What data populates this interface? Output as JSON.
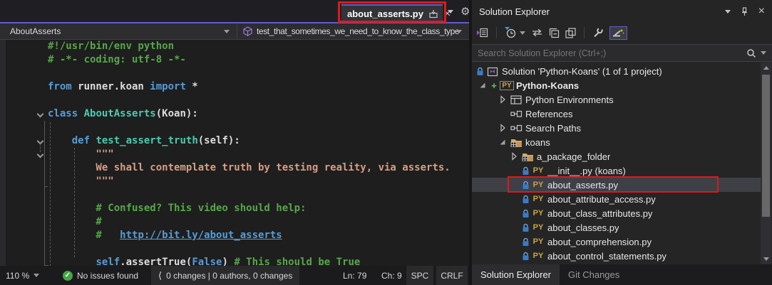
{
  "colors": {
    "accent_purple": "#5B5FC7",
    "annotation_red": "#DC1A1A",
    "selection_gray": "#3F3F46",
    "status_green": "#45A548",
    "token_palette": {
      "cm": "#57A64A",
      "kw": "#569CD6",
      "ty": "#4EC9B0",
      "st": "#D69D85",
      "tx": "#DCDCDC",
      "lk": "#569CD6"
    }
  },
  "editor": {
    "tab": {
      "label": "about_asserts.py"
    },
    "breadcrumb": {
      "left": "AboutAsserts",
      "right": "test_that_sometimes_we_need_to_know_the_class_type"
    },
    "code_lines": [
      {
        "tokens": [
          [
            "cm",
            "#!/usr/bin/env python"
          ]
        ]
      },
      {
        "tokens": [
          [
            "cm",
            "# -*- coding: utf-8 -*-"
          ]
        ]
      },
      {
        "tokens": []
      },
      {
        "tokens": [
          [
            "kw",
            "from"
          ],
          [
            "tx",
            " runner.koan "
          ],
          [
            "kw",
            "import"
          ],
          [
            "tx",
            " *"
          ]
        ]
      },
      {
        "tokens": []
      },
      {
        "fold": true,
        "tokens": [
          [
            "kw",
            "class"
          ],
          [
            "tx",
            " "
          ],
          [
            "ty",
            "AboutAsserts"
          ],
          [
            "tx",
            "(Koan):"
          ]
        ]
      },
      {
        "tokens": []
      },
      {
        "fold": true,
        "tokens": [
          [
            "tx",
            "    "
          ],
          [
            "kw",
            "def"
          ],
          [
            "tx",
            " "
          ],
          [
            "ty",
            "test_assert_truth"
          ],
          [
            "tx",
            "(self):"
          ]
        ]
      },
      {
        "fold": true,
        "tokens": [
          [
            "st",
            "        \"\"\""
          ]
        ]
      },
      {
        "tokens": [
          [
            "st",
            "        We shall contemplate truth by testing reality, via asserts."
          ]
        ]
      },
      {
        "tokens": [
          [
            "st",
            "        \"\"\""
          ]
        ]
      },
      {
        "tokens": []
      },
      {
        "tokens": [
          [
            "cm",
            "        # Confused? This video should help:"
          ]
        ]
      },
      {
        "tokens": [
          [
            "cm",
            "        #"
          ]
        ]
      },
      {
        "tokens": [
          [
            "cm",
            "        #   "
          ],
          [
            "lk",
            "http://bit.ly/about_asserts"
          ]
        ]
      },
      {
        "tokens": []
      },
      {
        "tokens": [
          [
            "tx",
            "        "
          ],
          [
            "kw",
            "self"
          ],
          [
            "tx",
            ".assertTrue("
          ],
          [
            "kw",
            "False"
          ],
          [
            "tx",
            ") "
          ],
          [
            "cm",
            "# This should be True"
          ]
        ]
      }
    ],
    "status": {
      "zoom": "110 %",
      "message": "No issues found",
      "changes": "0 changes | 0 authors, 0 changes",
      "line": "Ln: 79",
      "column": "Ch: 9",
      "spaces": "SPC",
      "eol": "CRLF"
    }
  },
  "panel": {
    "title": "Solution Explorer",
    "title_icons": [
      "window-position-icon",
      "pin-icon",
      "close-icon"
    ],
    "toolbar_icons": [
      "switch-views-icon",
      "pending-changes-filter-icon",
      "sync-with-active-document-icon",
      "collapse-all-icon",
      "show-all-files-icon",
      "properties-icon",
      "preview-selected-items-icon"
    ],
    "search": {
      "placeholder": "Search Solution Explorer (Ctrl+;)"
    },
    "tree": [
      {
        "label": "Solution 'Python-Koans' (1 of 1 project)",
        "level": 0,
        "expander": "none",
        "icon": "solution-icon",
        "lock": true
      },
      {
        "label": "Python-Koans",
        "level": 1,
        "expander": "open",
        "icon": "project-py-icon",
        "plus": true,
        "bold": true
      },
      {
        "label": "Python Environments",
        "level": 2,
        "expander": "closed",
        "icon": "python-env-icon"
      },
      {
        "label": "References",
        "level": 2,
        "expander": "none",
        "icon": "reference-icon"
      },
      {
        "label": "Search Paths",
        "level": 2,
        "expander": "closed",
        "icon": "reference-icon"
      },
      {
        "label": "koans",
        "level": 2,
        "expander": "open",
        "icon": "package-folder-icon"
      },
      {
        "label": "a_package_folder",
        "level": 3,
        "expander": "closed",
        "icon": "package-folder-icon"
      },
      {
        "label": "__init__.py (koans)",
        "level": 3,
        "expander": "none",
        "icon": "python-file-icon",
        "lock": true
      },
      {
        "label": "about_asserts.py",
        "level": 3,
        "expander": "none",
        "icon": "python-file-icon",
        "lock": true,
        "selected": true,
        "annotated": true
      },
      {
        "label": "about_attribute_access.py",
        "level": 3,
        "expander": "none",
        "icon": "python-file-icon",
        "lock": true
      },
      {
        "label": "about_class_attributes.py",
        "level": 3,
        "expander": "none",
        "icon": "python-file-icon",
        "lock": true
      },
      {
        "label": "about_classes.py",
        "level": 3,
        "expander": "none",
        "icon": "python-file-icon",
        "lock": true
      },
      {
        "label": "about_comprehension.py",
        "level": 3,
        "expander": "none",
        "icon": "python-file-icon",
        "lock": true
      },
      {
        "label": "about_control_statements.py",
        "level": 3,
        "expander": "none",
        "icon": "python-file-icon",
        "lock": true
      }
    ],
    "bottom_tabs": [
      {
        "label": "Solution Explorer",
        "active": true
      },
      {
        "label": "Git Changes",
        "active": false
      }
    ]
  }
}
